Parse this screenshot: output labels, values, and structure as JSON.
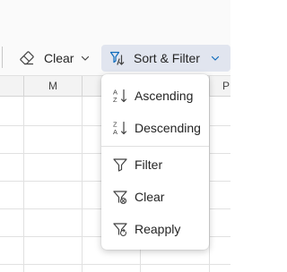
{
  "toolbar": {
    "clear_label": "Clear",
    "clear_icon": "eraser-icon",
    "sort_filter_label": "Sort & Filter",
    "sort_filter_icon": "sort-filter-icon",
    "chevron_icon": "chevron-down-icon",
    "active_button_bg": "#e1e5ef"
  },
  "grid": {
    "columns": [
      "M",
      "P"
    ]
  },
  "menu": {
    "sort_items": [
      {
        "label": "Ascending",
        "icon": "sort-ascending-icon"
      },
      {
        "label": "Descending",
        "icon": "sort-descending-icon"
      }
    ],
    "filter_items": [
      {
        "label": "Filter",
        "icon": "filter-icon"
      },
      {
        "label": "Clear",
        "icon": "filter-clear-icon"
      },
      {
        "label": "Reapply",
        "icon": "filter-reapply-icon"
      }
    ]
  },
  "colors": {
    "accent": "#0f6cbd",
    "text": "#242424",
    "icon": "#424242"
  }
}
